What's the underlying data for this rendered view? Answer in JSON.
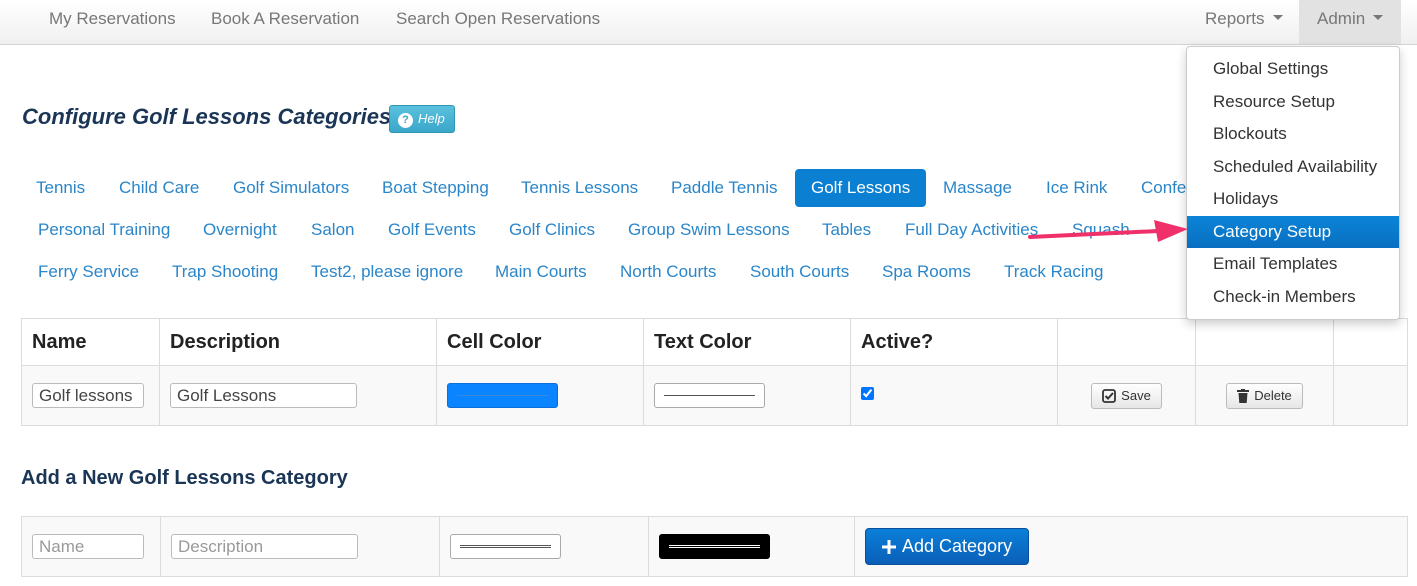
{
  "navbar": {
    "left": [
      "My Reservations",
      "Book A Reservation",
      "Search Open Reservations"
    ],
    "reports": "Reports",
    "admin": "Admin"
  },
  "admin_menu": {
    "items": [
      "Global Settings",
      "Resource Setup",
      "Blockouts",
      "Scheduled Availability",
      "Holidays",
      "Category Setup",
      "Email Templates",
      "Check-in Members"
    ],
    "active": "Category Setup"
  },
  "page": {
    "title": "Configure Golf Lessons Categories",
    "help": "Help"
  },
  "pills": {
    "row1": [
      "Tennis",
      "Child Care",
      "Golf Simulators",
      "Boat Stepping",
      "Tennis Lessons",
      "Paddle Tennis",
      "Golf Lessons",
      "Massage",
      "Ice Rink",
      "Confer"
    ],
    "row2": [
      "Personal Training",
      "Overnight",
      "Salon",
      "Golf Events",
      "Golf Clinics",
      "Group Swim Lessons",
      "Tables",
      "Full Day Activities",
      "Squash"
    ],
    "row3": [
      "Ferry Service",
      "Trap Shooting",
      "Test2, please ignore",
      "Main Courts",
      "North Courts",
      "South Courts",
      "Spa Rooms",
      "Track Racing"
    ],
    "active": "Golf Lessons"
  },
  "categories_table": {
    "headers": [
      "Name",
      "Description",
      "Cell Color",
      "Text Color",
      "Active?"
    ],
    "rows": [
      {
        "name": "Golf lessons",
        "description": "Golf Lessons",
        "cell_color": "#0a84ff",
        "text_color": "#ffffff",
        "active": true
      }
    ],
    "save_label": "Save",
    "delete_label": "Delete"
  },
  "add_section": {
    "title": "Add a New Golf Lessons Category",
    "name_placeholder": "Name",
    "description_placeholder": "Description",
    "cell_color": "#ffffff",
    "text_color": "#000000",
    "add_label": "Add Category"
  },
  "colors": {
    "link": "#2a86c9",
    "primary": "#0b80d3",
    "arrow": "#f0306a"
  }
}
